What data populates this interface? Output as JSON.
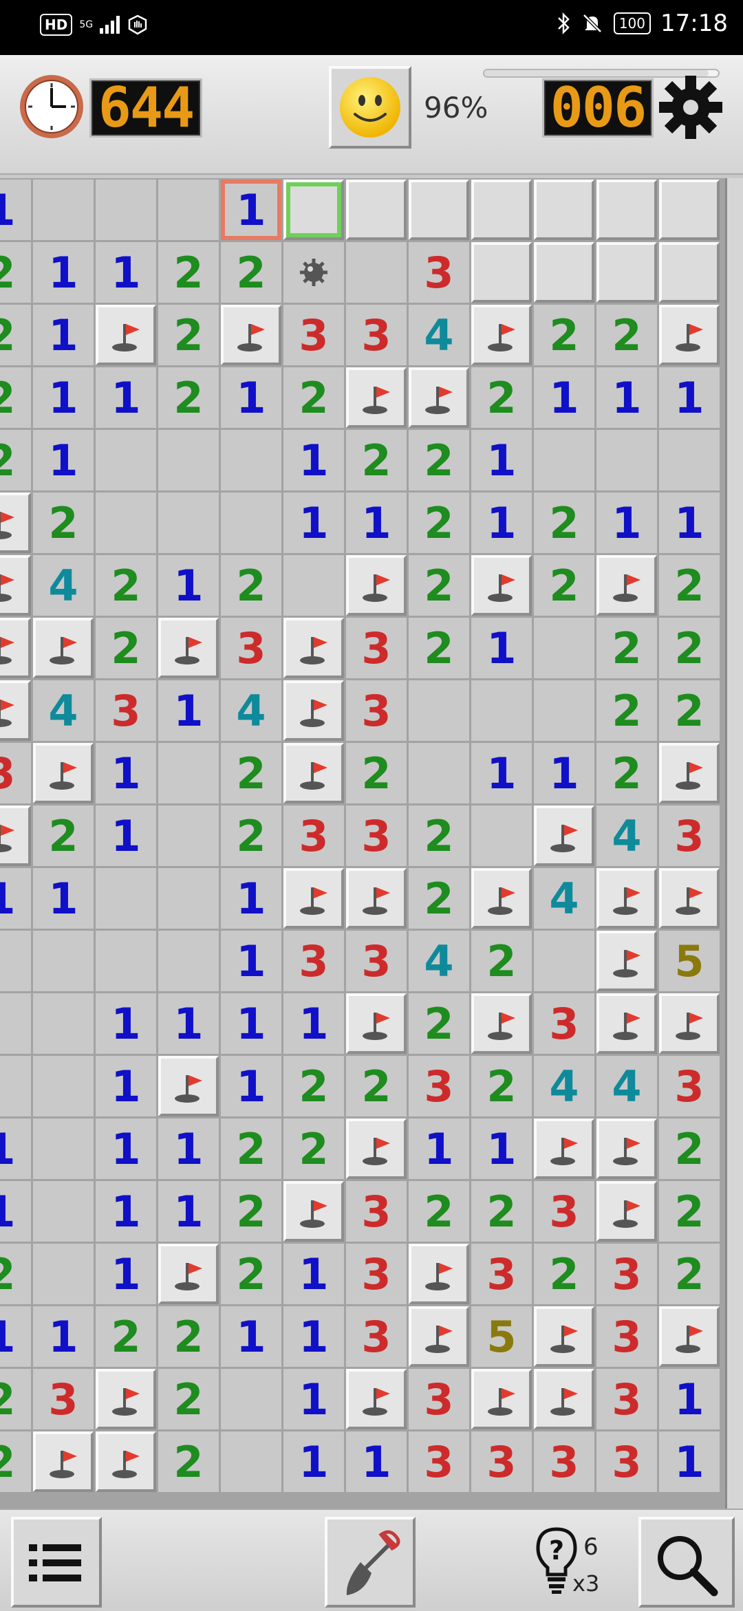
{
  "status_bar": {
    "network_badge": "HD",
    "network_type": "5G",
    "battery": "100",
    "time": "17:18"
  },
  "timer": {
    "value": "644"
  },
  "progress": {
    "percent_label": "96%",
    "value": 0.96
  },
  "mines_counter": {
    "value": "006"
  },
  "hints": {
    "count": "6",
    "multiplier": "x3"
  },
  "icons": {
    "clock": "clock-icon",
    "smiley": "smiley-face-icon",
    "settings": "gear-icon",
    "flag": "flag-icon",
    "mine": "mine-icon",
    "menu": "menu-list-icon",
    "dig": "shovel-icon",
    "hint": "lightbulb-hint-icon",
    "zoom": "magnifier-icon"
  },
  "colors": {
    "n1": "#1010c8",
    "n2": "#1e8c1e",
    "n3": "#cd2b2b",
    "n4": "#0f8a9b",
    "n5": "#8a7a0d",
    "lcd_digits": "#e89a16",
    "selected_red": "#e87a63",
    "selected_green": "#6fd05a"
  },
  "board": {
    "legend": "digits=number, .=revealed empty, #=unrevealed, F=flag, M=revealed mine, R=red-selected cell, G=green-selected cell",
    "rows": [
      "1...RG######",
      "21122M.3####",
      "21F2F334F22F",
      "211212FF2111",
      "21...1221...",
      "F2...1121211",
      "F4212.F2F2F2",
      "FF2F3F321.22F",
      "F4314F3...22",
      "3F1.2F2.112F",
      "F21.2332.F43",
      "11..1FF2F4FF",
      "....13342.F5",
      "..1111F2F3FF",
      "..1F12232443",
      "1.1122F11FF2",
      "1.112F3223F2",
      "2.1F213F3232",
      "1122113F5F3F",
      "23F2.1F3FF31",
      "2FF2.1133331"
    ]
  }
}
